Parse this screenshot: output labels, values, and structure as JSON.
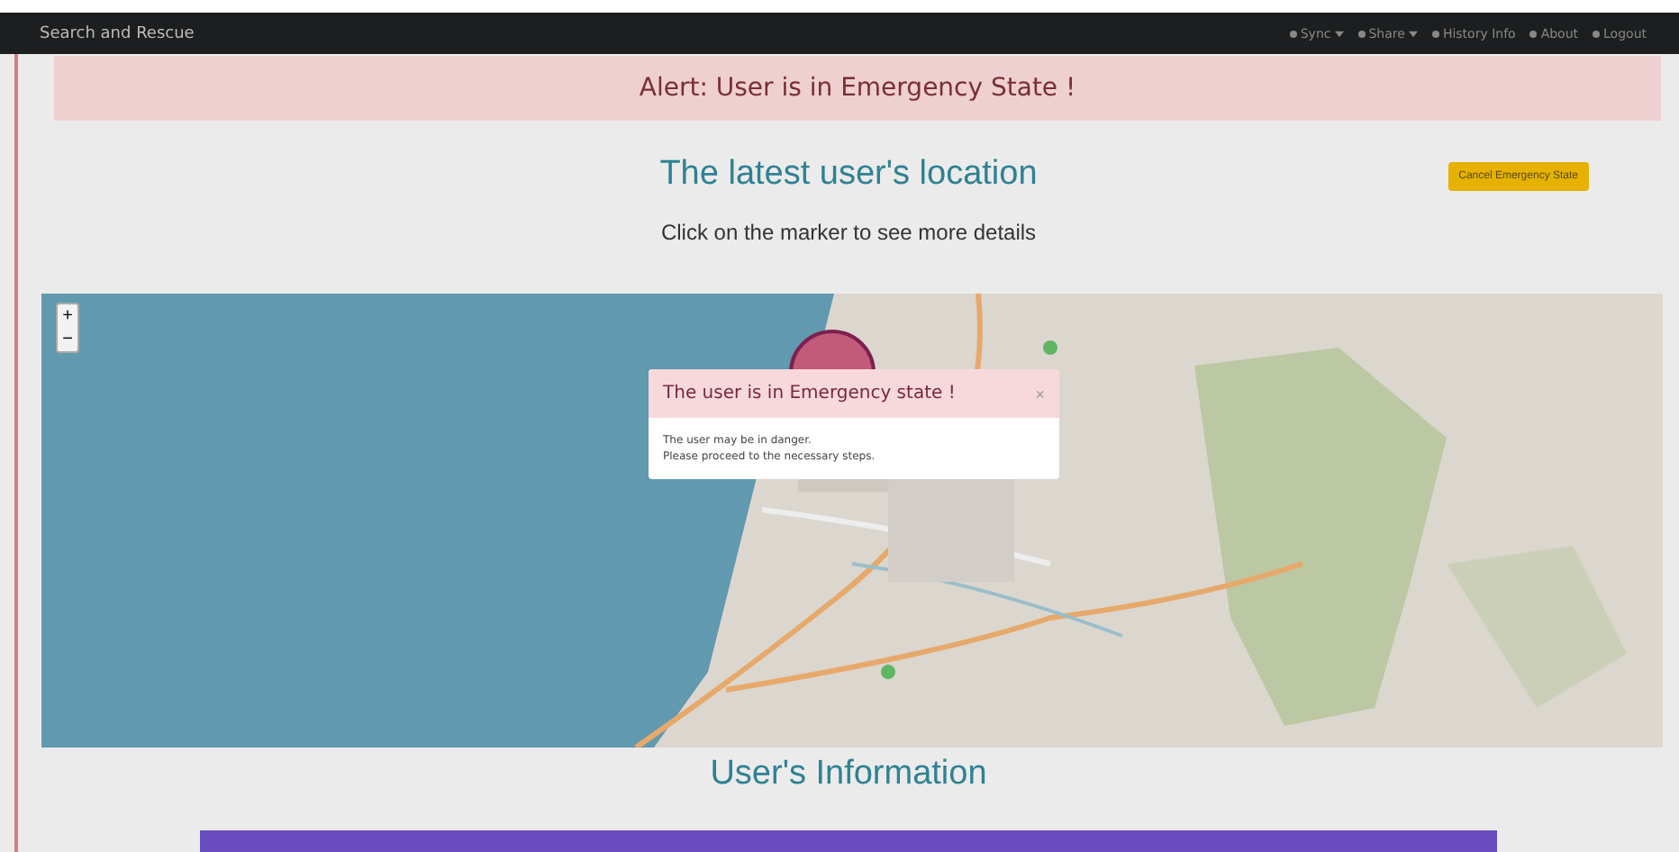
{
  "navbar": {
    "brand": "Search and Rescue",
    "items": [
      {
        "label": "Sync",
        "dropdown": true
      },
      {
        "label": "Share",
        "dropdown": true
      },
      {
        "label": "History Info",
        "dropdown": false
      },
      {
        "label": "About",
        "dropdown": false
      },
      {
        "label": "Logout",
        "dropdown": false
      }
    ]
  },
  "alert": "Alert: User is in Emergency State !",
  "location": {
    "title": "The latest user's location",
    "subtitle": "Click on the marker to see more details",
    "cancel_button": "Cancel Emergency State"
  },
  "map": {
    "zoom_in": "+",
    "zoom_out": "−"
  },
  "modal": {
    "title": "The user is in Emergency state !",
    "close": "×",
    "lines": [
      "The user may be in danger.",
      "Please proceed to the necessary steps."
    ]
  },
  "info": {
    "title": "User's Information"
  }
}
